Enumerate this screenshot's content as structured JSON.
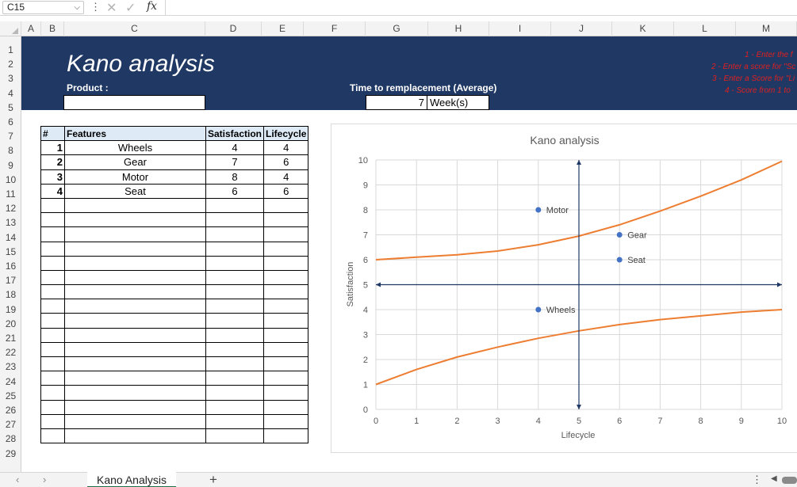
{
  "formula_bar": {
    "name_box": "C15",
    "fx": "fx",
    "formula": ""
  },
  "columns": [
    "A",
    "B",
    "C",
    "D",
    "E",
    "F",
    "G",
    "H",
    "I",
    "J",
    "K",
    "L",
    "M"
  ],
  "rows": [
    "1",
    "2",
    "3",
    "4",
    "5",
    "6",
    "7",
    "8",
    "9",
    "10",
    "11",
    "12",
    "13",
    "14",
    "15",
    "16",
    "17",
    "18",
    "19",
    "20",
    "21",
    "22",
    "23",
    "24",
    "25",
    "26",
    "27",
    "28",
    "29"
  ],
  "banner": {
    "title": "Kano analysis",
    "product_label": "Product :",
    "product_value": "",
    "time_label": "Time to remplacement (Average)",
    "time_value": "7",
    "time_unit": "Week(s)",
    "instructions": [
      "1 - Enter the f",
      "2 - Enter a score for \"Sc",
      "3 - Enter a Score for \"Li",
      "4 - Score from 1 to"
    ],
    "color": "#1f3864",
    "instruction_color": "#e02020"
  },
  "table": {
    "headers": [
      "#",
      "Features",
      "Satisfaction",
      "Lifecycle"
    ],
    "rows": [
      {
        "num": "1",
        "feature": "Wheels",
        "satisfaction": "4",
        "lifecycle": "4"
      },
      {
        "num": "2",
        "feature": "Gear",
        "satisfaction": "7",
        "lifecycle": "6"
      },
      {
        "num": "3",
        "feature": "Motor",
        "satisfaction": "8",
        "lifecycle": "4"
      },
      {
        "num": "4",
        "feature": "Seat",
        "satisfaction": "6",
        "lifecycle": "6"
      }
    ],
    "empty_rows": 17,
    "header_bg": "#deebf7"
  },
  "chart_data": {
    "type": "scatter",
    "title": "Kano analysis",
    "xlabel": "Lifecycle",
    "ylabel": "Satisfaction",
    "xlim": [
      0,
      10
    ],
    "ylim": [
      0,
      10
    ],
    "xticks": [
      0,
      1,
      2,
      3,
      4,
      5,
      6,
      7,
      8,
      9,
      10
    ],
    "yticks": [
      0,
      1,
      2,
      3,
      4,
      5,
      6,
      7,
      8,
      9,
      10
    ],
    "grid": true,
    "points": [
      {
        "label": "Wheels",
        "x": 4,
        "y": 4
      },
      {
        "label": "Gear",
        "x": 6,
        "y": 7
      },
      {
        "label": "Motor",
        "x": 4,
        "y": 8
      },
      {
        "label": "Seat",
        "x": 6,
        "y": 6
      }
    ],
    "curves": [
      {
        "x": [
          0,
          1,
          2,
          3,
          4,
          5,
          6,
          7,
          8,
          9,
          10
        ],
        "y": [
          6.0,
          6.1,
          6.2,
          6.35,
          6.6,
          6.95,
          7.4,
          7.95,
          8.55,
          9.2,
          9.95
        ]
      },
      {
        "x": [
          0,
          1,
          2,
          3,
          4,
          5,
          6,
          7,
          8,
          9,
          10
        ],
        "y": [
          1.0,
          1.6,
          2.1,
          2.5,
          2.85,
          3.15,
          3.4,
          3.6,
          3.75,
          3.9,
          4.0
        ]
      }
    ],
    "axes_cross": {
      "x": 5,
      "y": 5
    },
    "point_color": "#4472c4",
    "curve_color": "#ed7d31",
    "axis_color": "#1f3864"
  },
  "sheet_tabs": {
    "active": "Kano Analysis",
    "add": "+"
  }
}
